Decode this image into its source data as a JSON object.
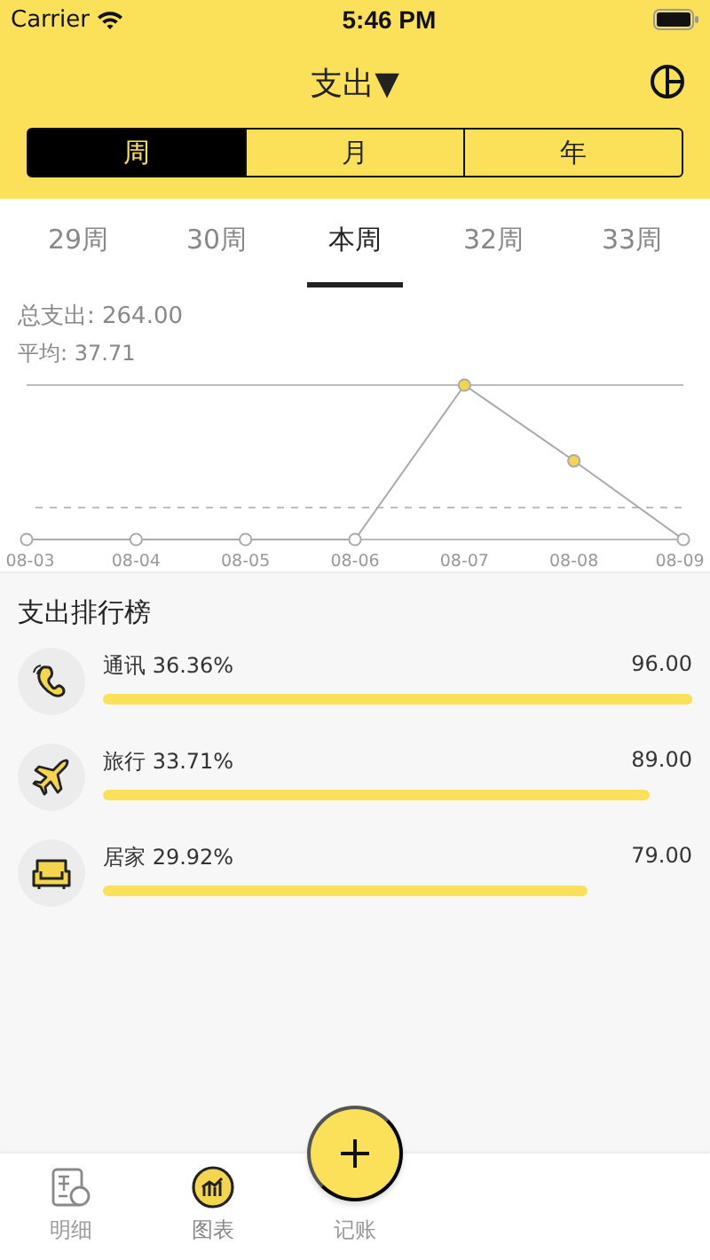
{
  "status_bar": {
    "carrier": "Carrier",
    "time": "5:46 PM"
  },
  "nav": {
    "title": "支出▼"
  },
  "periods": [
    {
      "label": "周",
      "selected": true
    },
    {
      "label": "月",
      "selected": false
    },
    {
      "label": "年",
      "selected": false
    }
  ],
  "weeks": [
    {
      "label": "29周",
      "selected": false
    },
    {
      "label": "30周",
      "selected": false
    },
    {
      "label": "本周",
      "selected": true
    },
    {
      "label": "32周",
      "selected": false
    },
    {
      "label": "33周",
      "selected": false
    }
  ],
  "summary": {
    "total": "总支出: 264.00",
    "average": "平均: 37.71"
  },
  "chart": {
    "x_labels": [
      "08-03",
      "08-04",
      "08-05",
      "08-06",
      "08-07",
      "08-08",
      "08-09"
    ]
  },
  "ranking": {
    "title": "支出排行榜",
    "items": [
      {
        "kind": "phone",
        "label": "通讯 36.36%",
        "amount": "96.00"
      },
      {
        "kind": "plane",
        "label": "旅行 33.71%",
        "amount": "89.00"
      },
      {
        "kind": "sofa",
        "label": "居家 29.92%",
        "amount": "79.00"
      }
    ]
  },
  "tab_bar": {
    "items": [
      {
        "kind": "list",
        "label": "明细",
        "selected": false
      },
      {
        "kind": "chart",
        "label": "图表",
        "selected": true
      },
      {
        "kind": "add",
        "label": "记账",
        "selected": false
      }
    ]
  }
}
